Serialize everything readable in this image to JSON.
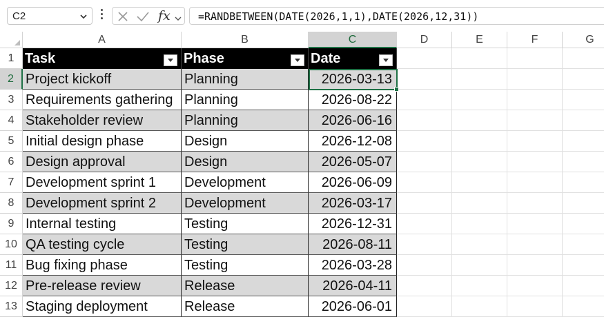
{
  "formula_bar": {
    "name_box": "C2",
    "fx_label": "fx",
    "formula": "=RANDBETWEEN(DATE(2026,1,1),DATE(2026,12,31))"
  },
  "columns": [
    "A",
    "B",
    "C",
    "D",
    "E",
    "F",
    "G"
  ],
  "selected_column": "C",
  "row_numbers": [
    "1",
    "2",
    "3",
    "4",
    "5",
    "6",
    "7",
    "8",
    "9",
    "10",
    "11",
    "12",
    "13"
  ],
  "selected_row": "2",
  "table": {
    "headers": {
      "task": "Task",
      "phase": "Phase",
      "date": "Date"
    },
    "rows": [
      {
        "task": "Project kickoff",
        "phase": "Planning",
        "date": "2026-03-13"
      },
      {
        "task": "Requirements gathering",
        "phase": "Planning",
        "date": "2026-08-22"
      },
      {
        "task": "Stakeholder review",
        "phase": "Planning",
        "date": "2026-06-16"
      },
      {
        "task": "Initial design phase",
        "phase": "Design",
        "date": "2026-12-08"
      },
      {
        "task": "Design approval",
        "phase": "Design",
        "date": "2026-05-07"
      },
      {
        "task": "Development sprint 1",
        "phase": "Development",
        "date": "2026-06-09"
      },
      {
        "task": "Development sprint 2",
        "phase": "Development",
        "date": "2026-03-17"
      },
      {
        "task": "Internal testing",
        "phase": "Testing",
        "date": "2026-12-31"
      },
      {
        "task": "QA testing cycle",
        "phase": "Testing",
        "date": "2026-08-11"
      },
      {
        "task": "Bug fixing phase",
        "phase": "Testing",
        "date": "2026-03-28"
      },
      {
        "task": "Pre-release review",
        "phase": "Release",
        "date": "2026-04-11"
      },
      {
        "task": "Staging deployment",
        "phase": "Release",
        "date": "2026-06-01"
      }
    ]
  },
  "colors": {
    "accent_green": "#1e7145",
    "header_fill": "#000000",
    "band_fill": "#d9d9d9"
  }
}
